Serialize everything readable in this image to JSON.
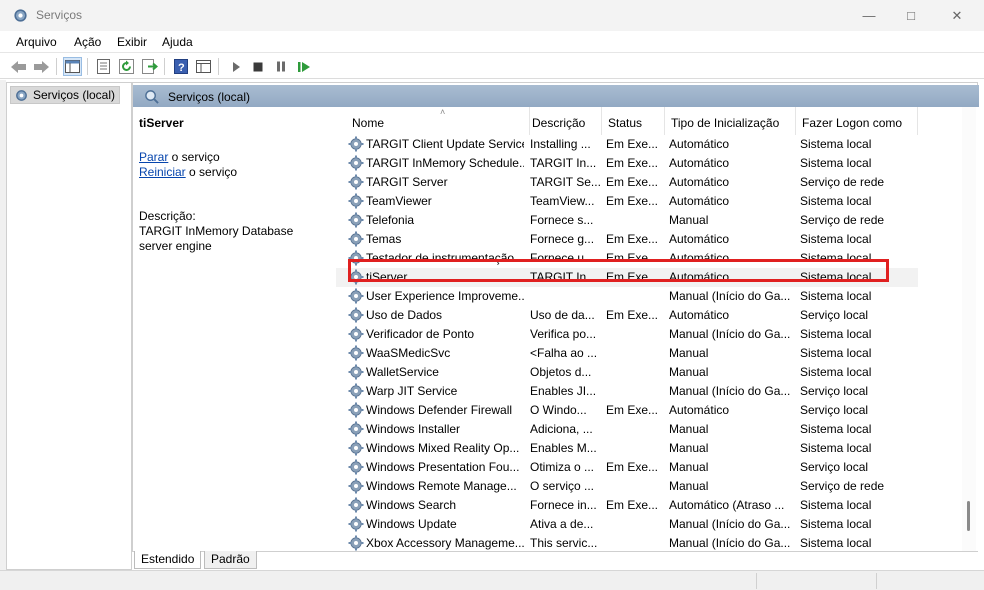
{
  "window": {
    "title": "Serviços"
  },
  "menu": [
    "Arquivo",
    "Ação",
    "Exibir",
    "Ajuda"
  ],
  "tree": {
    "root_label": "Serviços (local)"
  },
  "panel": {
    "header": "Serviços (local)"
  },
  "details": {
    "service_name": "tiServer",
    "stop_link": "Parar",
    "stop_suffix": " o serviço",
    "restart_link": "Reiniciar",
    "restart_suffix": " o serviço",
    "description_label": "Descrição:",
    "description_text": "TARGIT InMemory Database server engine"
  },
  "columns": [
    "Nome",
    "Descrição",
    "Status",
    "Tipo de Inicialização",
    "Fazer Logon como"
  ],
  "rows": [
    {
      "name": "TARGIT Client Update Service",
      "desc": "Installing ...",
      "status": "Em Exe...",
      "startup": "Automático",
      "logon": "Sistema local"
    },
    {
      "name": "TARGIT InMemory Schedule...",
      "desc": "TARGIT In...",
      "status": "Em Exe...",
      "startup": "Automático",
      "logon": "Sistema local"
    },
    {
      "name": "TARGIT Server",
      "desc": "TARGIT Se...",
      "status": "Em Exe...",
      "startup": "Automático",
      "logon": "Serviço de rede"
    },
    {
      "name": "TeamViewer",
      "desc": "TeamView...",
      "status": "Em Exe...",
      "startup": "Automático",
      "logon": "Sistema local"
    },
    {
      "name": "Telefonia",
      "desc": "Fornece s...",
      "status": "",
      "startup": "Manual",
      "logon": "Serviço de rede"
    },
    {
      "name": "Temas",
      "desc": "Fornece g...",
      "status": "Em Exe...",
      "startup": "Automático",
      "logon": "Sistema local"
    },
    {
      "name": "Testador de instrumentação...",
      "desc": "Fornece u...",
      "status": "Em Exe...",
      "startup": "Automático",
      "logon": "Sistema local"
    },
    {
      "name": "tiServer",
      "desc": "TARGIT In...",
      "status": "Em Exe...",
      "startup": "Automático",
      "logon": "Sistema local"
    },
    {
      "name": "User Experience Improveme...",
      "desc": "",
      "status": "",
      "startup": "Manual (Início do Ga...",
      "logon": "Sistema local"
    },
    {
      "name": "Uso de Dados",
      "desc": "Uso de da...",
      "status": "Em Exe...",
      "startup": "Automático",
      "logon": "Serviço local"
    },
    {
      "name": "Verificador de Ponto",
      "desc": "Verifica po...",
      "status": "",
      "startup": "Manual (Início do Ga...",
      "logon": "Sistema local"
    },
    {
      "name": "WaaSMedicSvc",
      "desc": "<Falha ao ...",
      "status": "",
      "startup": "Manual",
      "logon": "Sistema local"
    },
    {
      "name": "WalletService",
      "desc": "Objetos d...",
      "status": "",
      "startup": "Manual",
      "logon": "Sistema local"
    },
    {
      "name": "Warp JIT Service",
      "desc": "Enables JI...",
      "status": "",
      "startup": "Manual (Início do Ga...",
      "logon": "Serviço local"
    },
    {
      "name": "Windows Defender Firewall",
      "desc": "O Windo...",
      "status": "Em Exe...",
      "startup": "Automático",
      "logon": "Serviço local"
    },
    {
      "name": "Windows Installer",
      "desc": "Adiciona, ...",
      "status": "",
      "startup": "Manual",
      "logon": "Sistema local"
    },
    {
      "name": "Windows Mixed Reality Op...",
      "desc": "Enables M...",
      "status": "",
      "startup": "Manual",
      "logon": "Sistema local"
    },
    {
      "name": "Windows Presentation Fou...",
      "desc": "Otimiza o ...",
      "status": "Em Exe...",
      "startup": "Manual",
      "logon": "Serviço local"
    },
    {
      "name": "Windows Remote Manage...",
      "desc": "O serviço ...",
      "status": "",
      "startup": "Manual",
      "logon": "Serviço de rede"
    },
    {
      "name": "Windows Search",
      "desc": "Fornece in...",
      "status": "Em Exe...",
      "startup": "Automático (Atraso ...",
      "logon": "Sistema local"
    },
    {
      "name": "Windows Update",
      "desc": "Ativa a de...",
      "status": "",
      "startup": "Manual (Início do Ga...",
      "logon": "Sistema local"
    },
    {
      "name": "Xbox Accessory Manageme...",
      "desc": "This servic...",
      "status": "",
      "startup": "Manual (Início do Ga...",
      "logon": "Sistema local"
    }
  ],
  "selected_row": "tiServer",
  "tabs": {
    "extended": "Estendido",
    "standard": "Padrão"
  },
  "colors": {
    "highlight_border": "#e02020",
    "header_bar": "#9fb3ca",
    "link": "#0645ad"
  }
}
